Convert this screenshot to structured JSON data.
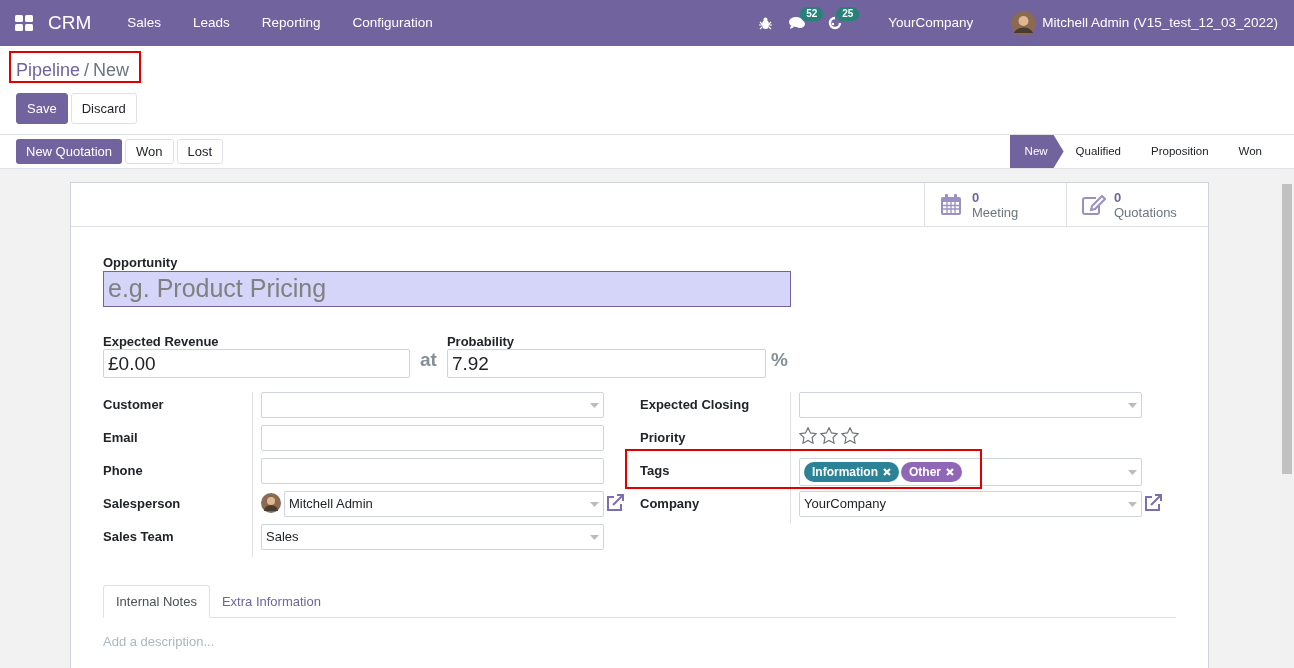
{
  "navbar": {
    "app_name": "CRM",
    "menu": [
      "Sales",
      "Leads",
      "Reporting",
      "Configuration"
    ],
    "messages_count": "52",
    "activities_count": "25",
    "company": "YourCompany",
    "user": "Mitchell Admin (V15_test_12_03_2022)"
  },
  "breadcrumb": {
    "highlighted": true,
    "separator": "/",
    "items": [
      {
        "label": "Pipeline",
        "kind": "link"
      },
      {
        "label": "New",
        "kind": "current"
      }
    ]
  },
  "form_buttons": [
    {
      "label": "Save",
      "primary": true
    },
    {
      "label": "Discard",
      "primary": false
    }
  ],
  "header_buttons": [
    {
      "label": "New Quotation",
      "primary": true
    },
    {
      "label": "Won",
      "primary": false
    },
    {
      "label": "Lost",
      "primary": false
    }
  ],
  "stages": [
    {
      "label": "New",
      "selected": true
    },
    {
      "label": "Qualified",
      "selected": false
    },
    {
      "label": "Proposition",
      "selected": false
    },
    {
      "label": "Won",
      "selected": false
    }
  ],
  "stat_buttons": [
    {
      "kind": "calendar",
      "count": "0",
      "label": "Meeting"
    },
    {
      "kind": "edit",
      "count": "0",
      "label": "Quotations"
    }
  ],
  "opportunity": {
    "label": "Opportunity",
    "placeholder": "e.g. Product Pricing"
  },
  "expected_revenue": {
    "label": "Expected Revenue",
    "value": "£0.00"
  },
  "at_text": "at",
  "probability": {
    "label": "Probability",
    "value": "7.92",
    "unit": "%"
  },
  "left_fields": [
    {
      "label": "Customer",
      "kind": "select"
    },
    {
      "label": "Email",
      "kind": "text"
    },
    {
      "label": "Phone",
      "kind": "text"
    },
    {
      "label": "Salesperson",
      "kind": "user",
      "value": "Mitchell Admin"
    },
    {
      "label": "Sales Team",
      "kind": "select",
      "value": "Sales"
    }
  ],
  "right_fields": [
    {
      "label": "Expected Closing",
      "kind": "select"
    },
    {
      "label": "Priority",
      "kind": "stars",
      "stars": 0
    },
    {
      "label": "Tags",
      "kind": "tags",
      "highlighted": true,
      "tags": [
        {
          "label": "Information",
          "color": "#2c8397"
        },
        {
          "label": "Other",
          "color": "#9067b7"
        }
      ]
    },
    {
      "label": "Company",
      "kind": "link_select",
      "value": "YourCompany"
    }
  ],
  "tabs": [
    {
      "label": "Internal Notes",
      "selected": true
    },
    {
      "label": "Extra Information",
      "selected": false
    }
  ],
  "description": {
    "placeholder": "Add a description..."
  }
}
